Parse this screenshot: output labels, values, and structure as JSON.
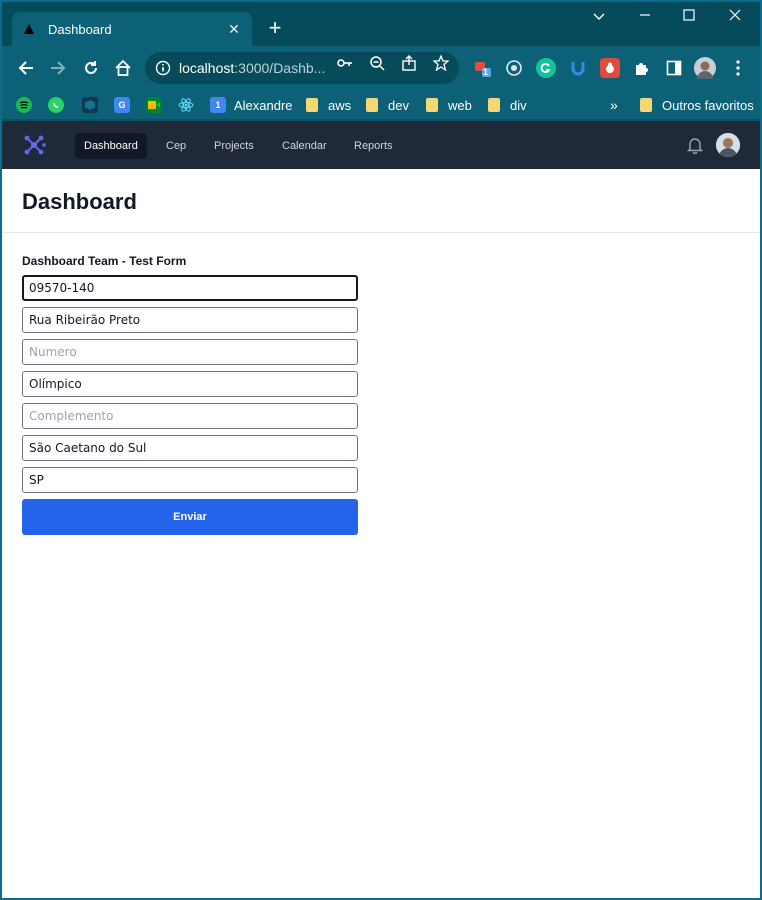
{
  "browser": {
    "tab_title": "Dashboard",
    "url_host": "localhost",
    "url_rest": ":3000/Dashb...",
    "extension_badge": "1",
    "bookmarks": {
      "alexandre": "Alexandre",
      "calendar_badge": "1",
      "aws": "aws",
      "dev": "dev",
      "web": "web",
      "div": "div",
      "more": "»",
      "others": "Outros favoritos"
    }
  },
  "app": {
    "nav": {
      "items": [
        "Dashboard",
        "Cep",
        "Projects",
        "Calendar",
        "Reports"
      ],
      "active": "Dashboard"
    },
    "page_title": "Dashboard",
    "form": {
      "title": "Dashboard Team - Test Form",
      "cep": "09570-140",
      "street": "Rua Ribeirão Preto",
      "number_placeholder": "Numero",
      "neighborhood": "Olímpico",
      "complement_placeholder": "Complemento",
      "city": "São Caetano do Sul",
      "state": "SP",
      "submit_label": "Enviar"
    },
    "colors": {
      "nav_bg": "#1f2937",
      "primary_button": "#2563eb",
      "logo": "#6366f1"
    }
  }
}
